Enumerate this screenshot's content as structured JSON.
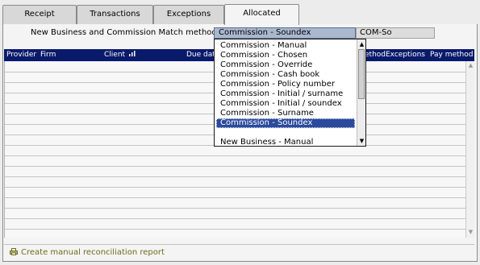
{
  "tabs": [
    {
      "label": "Receipt"
    },
    {
      "label": "Transactions"
    },
    {
      "label": "Exceptions"
    },
    {
      "label": "Allocated"
    }
  ],
  "match": {
    "label": "New Business and Commission Match method",
    "selected": "Commission - Soundex",
    "code": "COM-So",
    "options": [
      "Commission - Manual",
      "Commission - Chosen",
      "Commission - Override",
      "Commission - Cash book",
      "Commission - Policy number",
      "Commission - Initial / surname",
      "Commission - Initial / soundex",
      "Commission - Surname",
      "Commission - Soundex",
      "New Business - Manual"
    ]
  },
  "grid": {
    "columns": [
      "Provider",
      "Firm",
      "Client",
      "Due date",
      "ethod",
      "Exceptions",
      "Pay method"
    ]
  },
  "footer": {
    "report_link": "Create manual reconciliation report"
  },
  "colors": {
    "header_bg": "#0a1a6b",
    "selected_option": "#2b4a9c",
    "link": "#6d6d1e"
  }
}
